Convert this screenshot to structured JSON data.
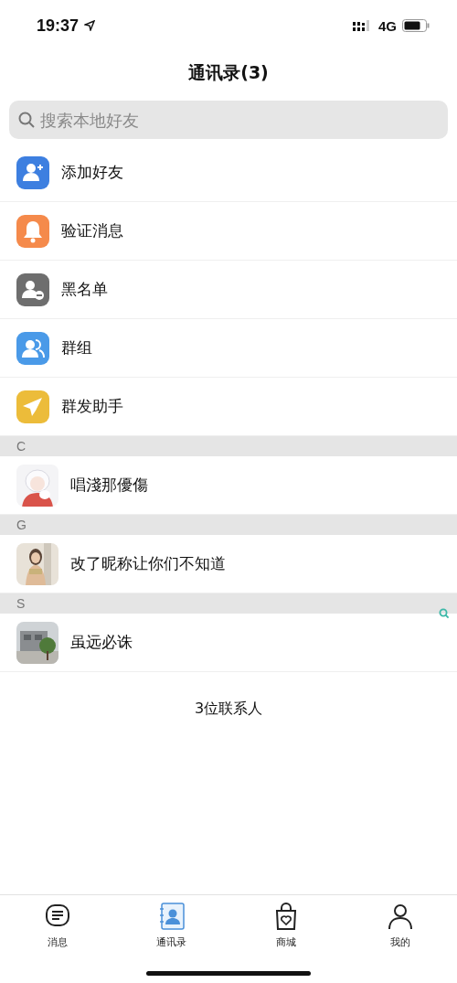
{
  "status_bar": {
    "time": "19:37",
    "network": "4G"
  },
  "title": "通讯录(3)",
  "search": {
    "placeholder": "搜索本地好友"
  },
  "menu": [
    {
      "label": "添加好友",
      "kind": "add-user",
      "color": "#3d7fe0"
    },
    {
      "label": "验证消息",
      "kind": "bell",
      "color": "#f58a4b"
    },
    {
      "label": "黑名单",
      "kind": "blocked-user",
      "color": "#6e6e6e"
    },
    {
      "label": "群组",
      "kind": "group",
      "color": "#4a9ae8"
    },
    {
      "label": "群发助手",
      "kind": "send",
      "color": "#ecbc3a"
    }
  ],
  "sections": [
    {
      "letter": "C",
      "contacts": [
        {
          "name": "唱淺那優傷"
        }
      ]
    },
    {
      "letter": "G",
      "contacts": [
        {
          "name": "改了昵称让你们不知道"
        }
      ]
    },
    {
      "letter": "S",
      "contacts": [
        {
          "name": "虽远必诛"
        }
      ]
    }
  ],
  "footer": "3位联系人",
  "tabs": [
    {
      "label": "消息",
      "kind": "chat",
      "selected": false
    },
    {
      "label": "通讯录",
      "kind": "contacts",
      "selected": true
    },
    {
      "label": "商城",
      "kind": "shop",
      "selected": false
    },
    {
      "label": "我的",
      "kind": "profile",
      "selected": false
    }
  ]
}
